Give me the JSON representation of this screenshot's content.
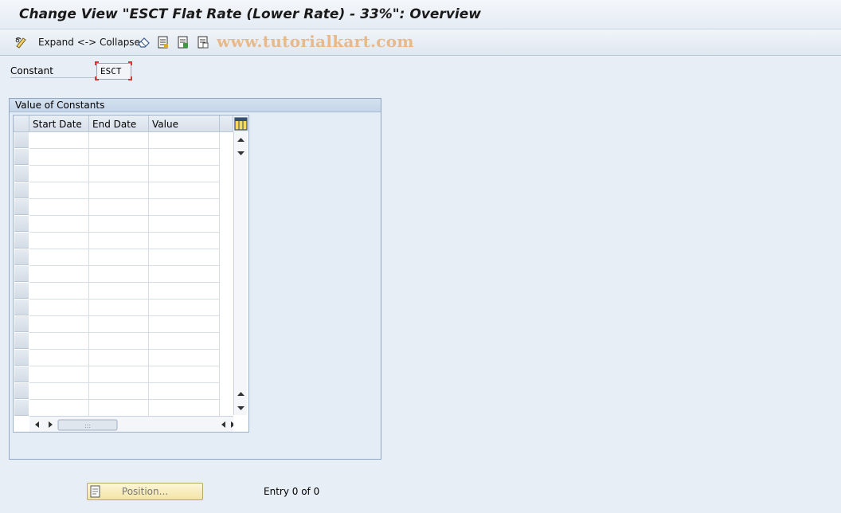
{
  "window": {
    "title": "Change View \"ESCT Flat Rate (Lower Rate) - 33%\": Overview"
  },
  "toolbar": {
    "expand_collapse_label": "Expand <-> Collapse",
    "watermark": "www.tutorialkart.com",
    "icons": [
      "pencil-glasses-icon",
      "eraser-icon",
      "details-icon",
      "select-all-icon",
      "deselect-all-icon"
    ]
  },
  "constant": {
    "label": "Constant",
    "value": "ESCT"
  },
  "group": {
    "title": "Value of Constants"
  },
  "table": {
    "columns": [
      "Start Date",
      "End Date",
      "Value"
    ],
    "row_count": 17,
    "rows": []
  },
  "footer": {
    "position_button_label": "Position...",
    "entry_text": "Entry 0 of 0"
  },
  "colors": {
    "background": "#e8eef5",
    "group_border": "#8fa7c3",
    "focus_corners": "#d23a3a",
    "watermark": "#e8b98a"
  }
}
